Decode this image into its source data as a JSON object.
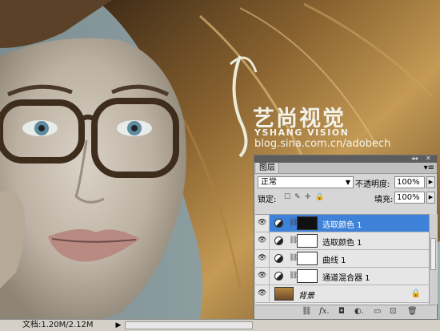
{
  "watermark": {
    "brand_cn": "艺尚视觉",
    "brand_en": "YSHANG VISION",
    "url": "blog.sina.com.cn/adobech"
  },
  "status": {
    "doc_info": "文档:1.20M/2.12M",
    "arrow": "▶"
  },
  "panel": {
    "tab_label": "图层",
    "menu_icon": "panel-menu-icon",
    "blend_mode": "正常",
    "opacity_label": "不透明度:",
    "opacity_value": "100%",
    "lock_label": "锁定:",
    "fill_label": "填充:",
    "fill_value": "100%",
    "layers": [
      {
        "name": "选取颜色 1",
        "type": "adjustment",
        "mask": "dark",
        "selected": true
      },
      {
        "name": "选取颜色 1",
        "type": "adjustment",
        "mask": "white",
        "selected": false
      },
      {
        "name": "曲线 1",
        "type": "adjustment",
        "mask": "white",
        "selected": false
      },
      {
        "name": "通道混合器 1",
        "type": "adjustment",
        "mask": "white",
        "selected": false
      },
      {
        "name": "背景",
        "type": "background",
        "locked": true,
        "selected": false
      }
    ],
    "bottom_icons": [
      "link-icon",
      "fx-icon",
      "mask-icon",
      "adjustment-icon",
      "group-icon",
      "new-layer-icon",
      "trash-icon"
    ],
    "bottom_glyphs": {
      "link": "⛓",
      "fx": "fx.",
      "mask": "◘",
      "adj": "◐.",
      "group": "▭",
      "new": "⊡",
      "trash": "🗑"
    }
  },
  "colors": {
    "selected_layer": "#3d82d8",
    "panel_bg": "#d6d6d6"
  }
}
